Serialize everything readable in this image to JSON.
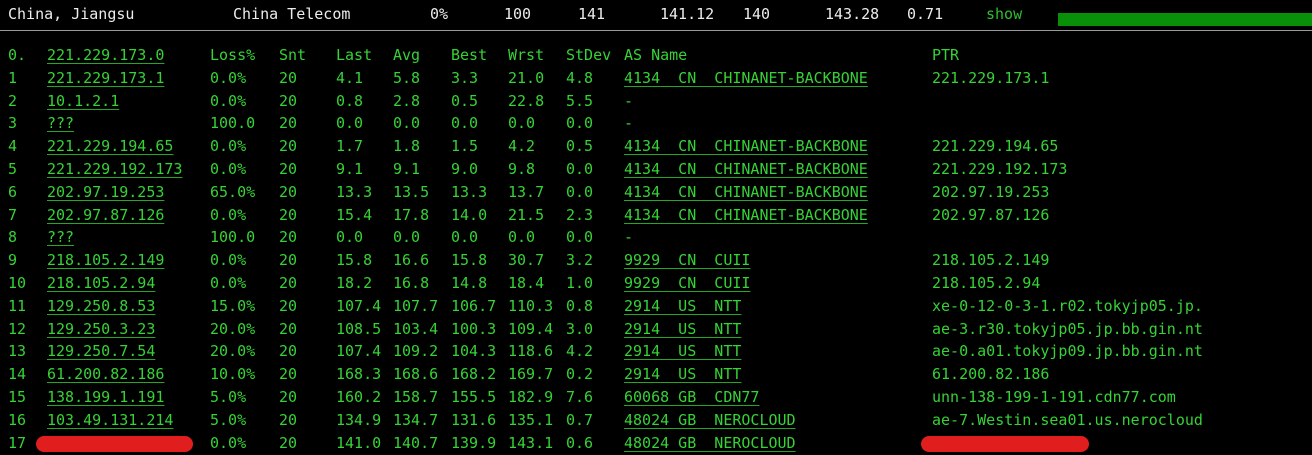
{
  "header": {
    "location": "China, Jiangsu",
    "isp": "China Telecom",
    "loss": "0%",
    "sent": "100",
    "last": "141",
    "avg": "141.12",
    "best": "140",
    "worst": "143.28",
    "stdev": "0.71",
    "show_label": "show",
    "bar_fill_fraction": 1.0,
    "bar_color": "#089008"
  },
  "columns": {
    "hop": "0.",
    "host": "221.229.173.0",
    "loss": "Loss%",
    "snt": "Snt",
    "last": "Last",
    "avg": "Avg",
    "best": "Best",
    "wrst": "Wrst",
    "stdev": "StDev",
    "asname": "AS Name",
    "ptr": "PTR"
  },
  "hops": [
    {
      "hop": "1",
      "host": "221.229.173.1",
      "loss": "0.0%",
      "snt": "20",
      "last": "4.1",
      "avg": "5.8",
      "best": "3.3",
      "wrst": "21.0",
      "stdev": "4.8",
      "asname": "4134  CN  CHINANET-BACKBONE",
      "ptr": "221.229.173.1"
    },
    {
      "hop": "2",
      "host": "10.1.2.1",
      "loss": "0.0%",
      "snt": "20",
      "last": "0.8",
      "avg": "2.8",
      "best": "0.5",
      "wrst": "22.8",
      "stdev": "5.5",
      "asname": "-",
      "ptr": ""
    },
    {
      "hop": "3",
      "host": "???",
      "loss": "100.0",
      "snt": "20",
      "last": "0.0",
      "avg": "0.0",
      "best": "0.0",
      "wrst": "0.0",
      "stdev": "0.0",
      "asname": "-",
      "ptr": ""
    },
    {
      "hop": "4",
      "host": "221.229.194.65",
      "loss": "0.0%",
      "snt": "20",
      "last": "1.7",
      "avg": "1.8",
      "best": "1.5",
      "wrst": "4.2",
      "stdev": "0.5",
      "asname": "4134  CN  CHINANET-BACKBONE",
      "ptr": "221.229.194.65"
    },
    {
      "hop": "5",
      "host": "221.229.192.173",
      "loss": "0.0%",
      "snt": "20",
      "last": "9.1",
      "avg": "9.1",
      "best": "9.0",
      "wrst": "9.8",
      "stdev": "0.0",
      "asname": "4134  CN  CHINANET-BACKBONE",
      "ptr": "221.229.192.173"
    },
    {
      "hop": "6",
      "host": "202.97.19.253",
      "loss": "65.0%",
      "snt": "20",
      "last": "13.3",
      "avg": "13.5",
      "best": "13.3",
      "wrst": "13.7",
      "stdev": "0.0",
      "asname": "4134  CN  CHINANET-BACKBONE",
      "ptr": "202.97.19.253"
    },
    {
      "hop": "7",
      "host": "202.97.87.126",
      "loss": "0.0%",
      "snt": "20",
      "last": "15.4",
      "avg": "17.8",
      "best": "14.0",
      "wrst": "21.5",
      "stdev": "2.3",
      "asname": "4134  CN  CHINANET-BACKBONE",
      "ptr": "202.97.87.126"
    },
    {
      "hop": "8",
      "host": "???",
      "loss": "100.0",
      "snt": "20",
      "last": "0.0",
      "avg": "0.0",
      "best": "0.0",
      "wrst": "0.0",
      "stdev": "0.0",
      "asname": "-",
      "ptr": ""
    },
    {
      "hop": "9",
      "host": "218.105.2.149",
      "loss": "0.0%",
      "snt": "20",
      "last": "15.8",
      "avg": "16.6",
      "best": "15.8",
      "wrst": "30.7",
      "stdev": "3.2",
      "asname": "9929  CN  CUII",
      "ptr": "218.105.2.149"
    },
    {
      "hop": "10",
      "host": "218.105.2.94",
      "loss": "0.0%",
      "snt": "20",
      "last": "18.2",
      "avg": "16.8",
      "best": "14.8",
      "wrst": "18.4",
      "stdev": "1.0",
      "asname": "9929  CN  CUII",
      "ptr": "218.105.2.94"
    },
    {
      "hop": "11",
      "host": "129.250.8.53",
      "loss": "15.0%",
      "snt": "20",
      "last": "107.4",
      "avg": "107.7",
      "best": "106.7",
      "wrst": "110.3",
      "stdev": "0.8",
      "asname": "2914  US  NTT",
      "ptr": "xe-0-12-0-3-1.r02.tokyjp05.jp."
    },
    {
      "hop": "12",
      "host": "129.250.3.23",
      "loss": "20.0%",
      "snt": "20",
      "last": "108.5",
      "avg": "103.4",
      "best": "100.3",
      "wrst": "109.4",
      "stdev": "3.0",
      "asname": "2914  US  NTT",
      "ptr": "ae-3.r30.tokyjp05.jp.bb.gin.nt"
    },
    {
      "hop": "13",
      "host": "129.250.7.54",
      "loss": "20.0%",
      "snt": "20",
      "last": "107.4",
      "avg": "109.2",
      "best": "104.3",
      "wrst": "118.6",
      "stdev": "4.2",
      "asname": "2914  US  NTT",
      "ptr": "ae-0.a01.tokyjp09.jp.bb.gin.nt"
    },
    {
      "hop": "14",
      "host": "61.200.82.186",
      "loss": "10.0%",
      "snt": "20",
      "last": "168.3",
      "avg": "168.6",
      "best": "168.2",
      "wrst": "169.7",
      "stdev": "0.2",
      "asname": "2914  US  NTT",
      "ptr": "61.200.82.186"
    },
    {
      "hop": "15",
      "host": "138.199.1.191",
      "loss": "5.0%",
      "snt": "20",
      "last": "160.2",
      "avg": "158.7",
      "best": "155.5",
      "wrst": "182.9",
      "stdev": "7.6",
      "asname": "60068 GB  CDN77",
      "ptr": "unn-138-199-1-191.cdn77.com"
    },
    {
      "hop": "16",
      "host": "103.49.131.214",
      "loss": "5.0%",
      "snt": "20",
      "last": "134.9",
      "avg": "134.7",
      "best": "131.6",
      "wrst": "135.1",
      "stdev": "0.7",
      "asname": "48024 GB  NEROCLOUD",
      "ptr": "ae-7.Westin.sea01.us.nerocloud"
    },
    {
      "hop": "17",
      "host": "",
      "loss": "0.0%",
      "snt": "20",
      "last": "141.0",
      "avg": "140.7",
      "best": "139.9",
      "wrst": "143.1",
      "stdev": "0.6",
      "asname": "48024 GB  NEROCLOUD",
      "ptr": ""
    }
  ],
  "colors": {
    "background": "#000000",
    "text_green": "#36d236",
    "header_text": "#ececec",
    "redaction": "#e01e1e"
  }
}
